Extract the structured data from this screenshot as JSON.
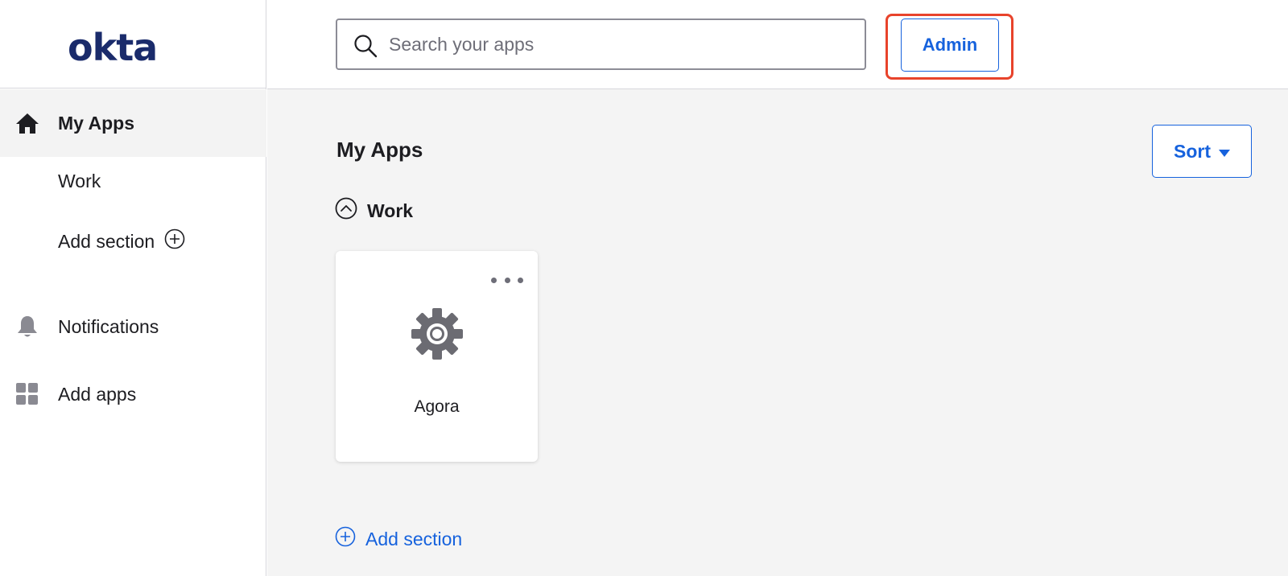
{
  "brand": {
    "logo_text": "okta",
    "logo_color": "#1a2b6b"
  },
  "header": {
    "search_placeholder": "Search your apps",
    "search_value": "",
    "admin_label": "Admin",
    "highlight_color": "#e8432b"
  },
  "sidebar": {
    "items": [
      {
        "label": "My Apps",
        "icon": "home-icon",
        "active": true
      },
      {
        "label": "Work"
      },
      {
        "label": "Add section",
        "icon": "plus-circle-icon"
      },
      {
        "label": "Notifications",
        "icon": "bell-icon"
      },
      {
        "label": "Add apps",
        "icon": "grid-icon"
      }
    ]
  },
  "main": {
    "title": "My Apps",
    "sort_label": "Sort",
    "section": {
      "label": "Work",
      "icon": "chevron-up-circle-icon"
    },
    "apps": [
      {
        "name": "Agora",
        "icon": "gear-icon"
      }
    ],
    "add_section_label": "Add section"
  },
  "colors": {
    "accent": "#1662dd",
    "main_bg": "#f4f4f4"
  }
}
